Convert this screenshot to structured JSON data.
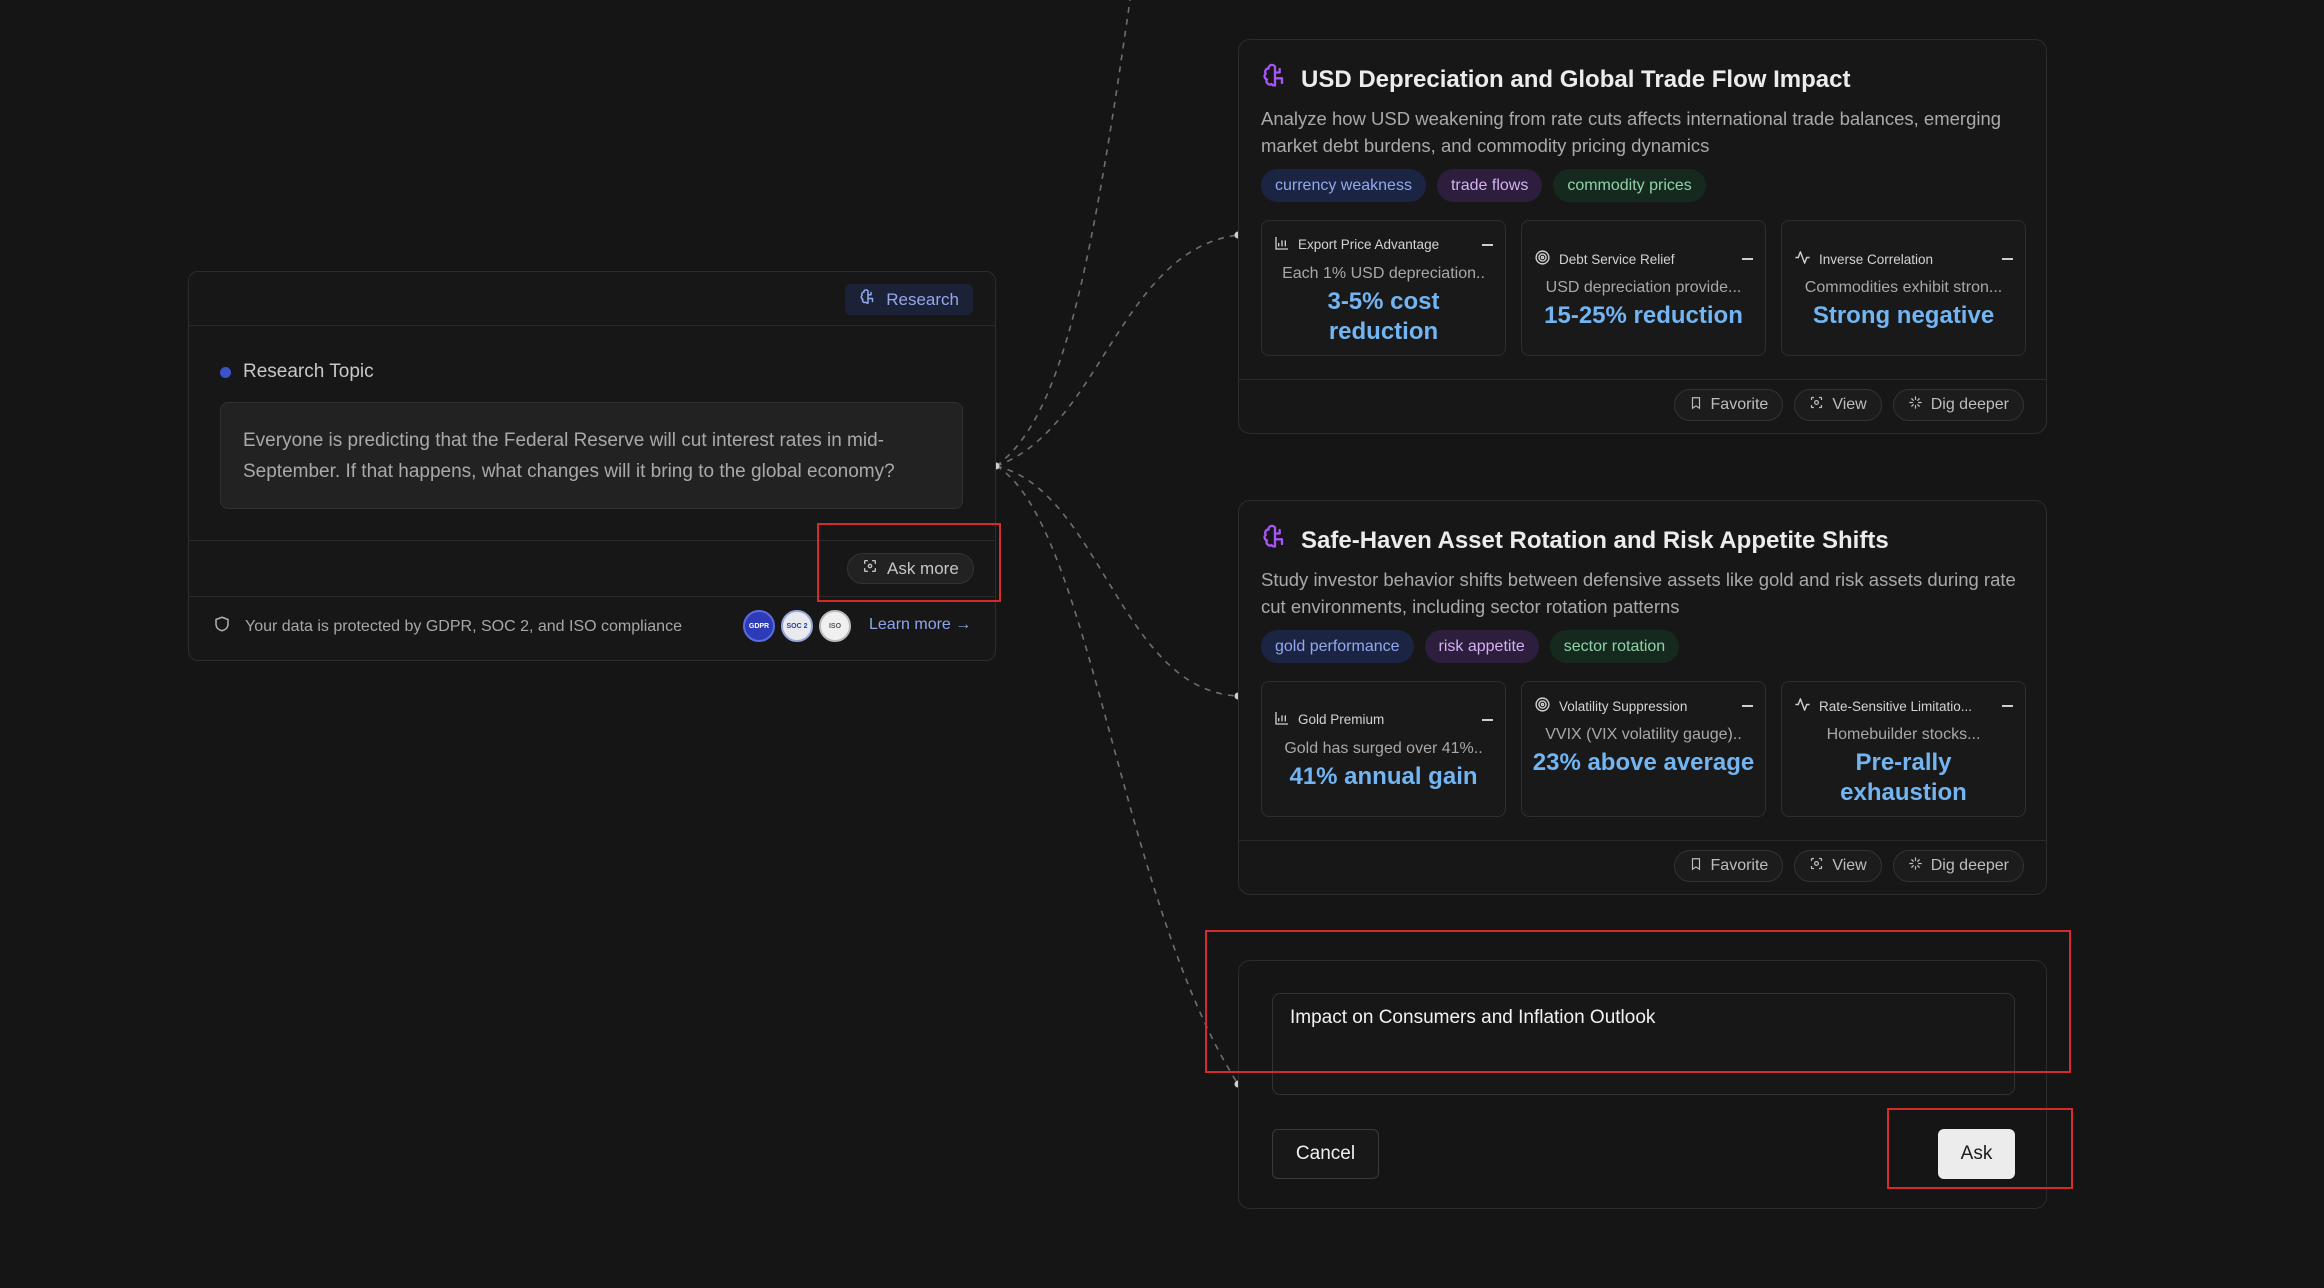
{
  "source": {
    "chip_label": "Research",
    "topic_label": "Research Topic",
    "topic_text": "Everyone is predicting that the Federal Reserve will cut interest rates in mid-September. If that happens, what changes will it bring to the global economy?",
    "ask_more_label": "Ask more",
    "privacy_text": "Your data is protected by GDPR, SOC 2, and ISO compliance",
    "badges": [
      "GDPR",
      "SOC 2",
      "ISO"
    ],
    "learn_more": "Learn more →"
  },
  "cards": [
    {
      "title": "USD Depreciation and Global Trade Flow Impact",
      "description": "Analyze how USD weakening from rate cuts affects international trade balances, emerging market debt burdens, and commodity pricing dynamics",
      "tags": [
        "currency weakness",
        "trade flows",
        "commodity prices"
      ],
      "metrics": [
        {
          "icon": "bar-chart-icon",
          "name": "Export Price Advantage",
          "sub": "Each 1% USD depreciation..",
          "value": "3-5% cost reduction"
        },
        {
          "icon": "target-icon",
          "name": "Debt Service Relief",
          "sub": "USD depreciation provide...",
          "value": "15-25% reduction"
        },
        {
          "icon": "activity-icon",
          "name": "Inverse Correlation",
          "sub": "Commodities exhibit stron...",
          "value": "Strong negative"
        }
      ]
    },
    {
      "title": "Safe-Haven Asset Rotation and Risk Appetite Shifts",
      "description": "Study investor behavior shifts between defensive assets like gold and risk assets during rate cut environments, including sector rotation patterns",
      "tags": [
        "gold performance",
        "risk appetite",
        "sector rotation"
      ],
      "metrics": [
        {
          "icon": "bar-chart-icon",
          "name": "Gold Premium",
          "sub": "Gold has surged over 41%..",
          "value": "41% annual gain"
        },
        {
          "icon": "target-icon",
          "name": "Volatility Suppression",
          "sub": "VVIX (VIX volatility gauge)..",
          "value": "23% above average"
        },
        {
          "icon": "activity-icon",
          "name": "Rate-Sensitive Limitatio...",
          "sub": "Homebuilder stocks...",
          "value": "Pre-rally exhaustion"
        }
      ]
    }
  ],
  "actions": {
    "favorite": "Favorite",
    "view": "View",
    "dig": "Dig deeper"
  },
  "ask": {
    "input_value": "Impact on Consumers and Inflation Outlook",
    "cancel": "Cancel",
    "submit": "Ask"
  },
  "colors": {
    "accent_blue": "#72b5f2",
    "highlight_red": "#d42a2a",
    "brain_purple": "#a855f7"
  }
}
